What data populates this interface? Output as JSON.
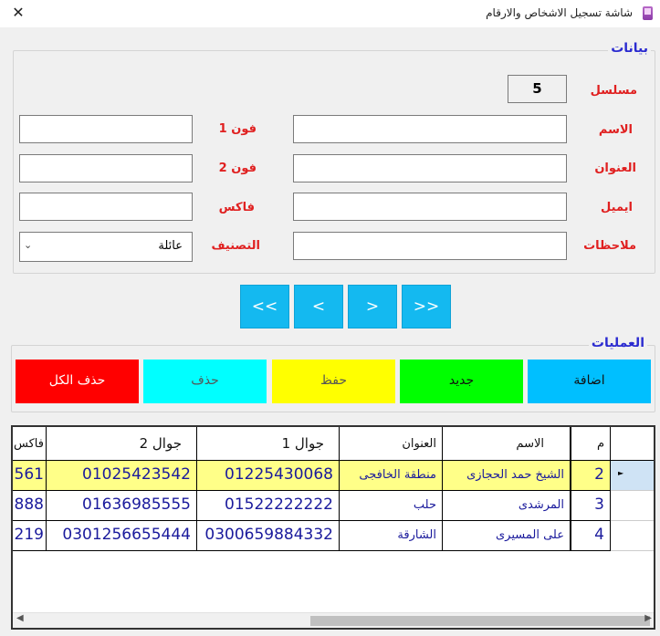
{
  "window": {
    "title": "شاشة تسجيل الاشخاص والارقام",
    "close_glyph": "✕",
    "app_icon": "phone-book-icon"
  },
  "data_group": {
    "legend": "بيانات",
    "serial_label": "مسلسل",
    "serial_value": "5",
    "name_label": "الاسم",
    "address_label": "العنوان",
    "email_label": "ايميل",
    "notes_label": "ملاحظات",
    "phone1_label": "فون 1",
    "phone2_label": "فون 2",
    "fax_label": "فاكس",
    "category_label": "التصنيف",
    "category_value": "عائلة",
    "name_value": "",
    "address_value": "",
    "email_value": "",
    "notes_value": "",
    "phone1_value": "",
    "phone2_value": "",
    "fax_value": ""
  },
  "nav": {
    "first": "<<",
    "prev": "<",
    "next": ">",
    "last": ">>"
  },
  "operations": {
    "legend": "العمليات",
    "add": "اضافة",
    "new": "جديد",
    "save": "حفظ",
    "delete": "حذف",
    "delete_all": "حذف الكل",
    "colors": {
      "add": "#00bfff",
      "new": "#00ff00",
      "save": "#ffff00",
      "delete": "#00ffff",
      "delete_all": "#ff0000"
    }
  },
  "grid": {
    "headers": {
      "m": "م",
      "name": "الاسم",
      "address": "العنوان",
      "mobile1": "جوال 1",
      "mobile2": "جوال 2",
      "fax": "فاكس"
    },
    "rows": [
      {
        "m": "2",
        "name": "الشيخ حمد الحجازى",
        "address": "منطقة الخافجى",
        "mobile1": "01225430068",
        "mobile2": "01025423542",
        "fax": "561"
      },
      {
        "m": "3",
        "name": "المرشدى",
        "address": "حلب",
        "mobile1": "01522222222",
        "mobile2": "01636985555",
        "fax": "888"
      },
      {
        "m": "4",
        "name": "على المسيرى",
        "address": "الشارقة",
        "mobile1": "0300659884332",
        "mobile2": "0301256655444",
        "fax": "219"
      }
    ],
    "selected_row_color": "#ffff88"
  }
}
